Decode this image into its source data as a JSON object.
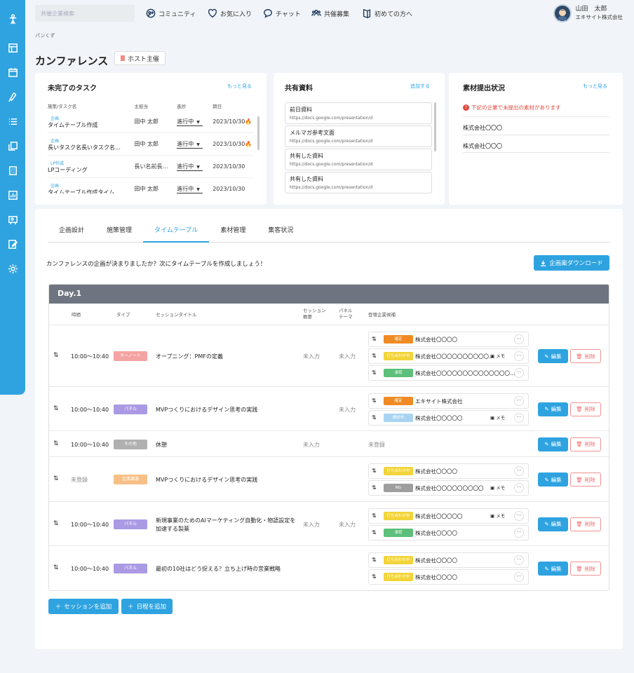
{
  "search": {
    "placeholder": "共催企業検索"
  },
  "topnav": [
    {
      "label": "コミュニティ",
      "icon": "community-icon"
    },
    {
      "label": "お気に入り",
      "icon": "heart-icon"
    },
    {
      "label": "チャット",
      "icon": "chat-icon"
    },
    {
      "label": "共催募集",
      "icon": "people-icon"
    },
    {
      "label": "初めての方へ",
      "icon": "book-icon"
    }
  ],
  "user": {
    "name": "山田　太郎",
    "company": "エキサイト株式会社"
  },
  "breadcrumb": "パンくず",
  "page": {
    "title": "カンファレンス",
    "host_badge": "ホスト主催"
  },
  "tasks": {
    "title": "未完了のタスク",
    "more": "もっと見る",
    "headers": [
      "施策/タスク名",
      "主担当",
      "進捗",
      "期日"
    ],
    "rows": [
      {
        "category": "企画",
        "name": "タイムテーブル作成",
        "owner": "田中 太郎",
        "status": "進行中",
        "due": "2023/10/30",
        "flame": true
      },
      {
        "category": "企画",
        "name": "長いタスク名長いタスク名…",
        "owner": "田中 太郎",
        "status": "進行中",
        "due": "2023/10/30",
        "flame": true
      },
      {
        "category": "LP作成",
        "name": "LPコーディング",
        "owner": "長い名前長…",
        "status": "進行中",
        "due": "2023/10/30",
        "flame": false
      },
      {
        "category": "企画",
        "name": "タイムテーブル作成タイム…",
        "owner": "田中 太郎",
        "status": "進行中",
        "due": "2023/10/30",
        "flame": false
      }
    ]
  },
  "docs": {
    "title": "共有資料",
    "add": "追加する",
    "items": [
      {
        "title": "前日資料",
        "url": "https://docs.google.com/presentation/d"
      },
      {
        "title": "メルマガ参考文面",
        "url": "https://docs.google.com/presentation/d"
      },
      {
        "title": "共有した資料",
        "url": "https://docs.google.com/presentation/d"
      },
      {
        "title": "共有した資料",
        "url": "https://docs.google.com/presentation/d"
      }
    ]
  },
  "materials": {
    "title": "素材提出状況",
    "more": "もっと見る",
    "warning": "下記の企業で未提出の素材があります",
    "companies": [
      "株式会社〇〇〇",
      "株式会社〇〇〇"
    ]
  },
  "tabs": [
    "企画設計",
    "施策管理",
    "タイムテーブル",
    "素材管理",
    "集客状況"
  ],
  "intro": "カンファレンスの企画が決まりましたか？次にタイムテーブルを作成しましょう！",
  "download_label": "企画案ダウンロード",
  "day": {
    "label": "Day.1",
    "headers": {
      "time": "時間",
      "type": "タイプ",
      "title": "セッションタイトル",
      "overview": "セッション\n概要",
      "panel": "パネル\nテーマ",
      "companies": "登壇企業候補"
    },
    "edit_label": "編集",
    "delete_label": "削除",
    "memo_label": "メモ",
    "sessions": [
      {
        "time": "10:00〜10:40",
        "type": "キーノート",
        "type_color": "#f4a3a3",
        "title": "オープニング：PMFの定義",
        "overview": "未入力",
        "panel": "未入力",
        "entries": [
          {
            "status": "確定",
            "color": "#f08a24",
            "name": "株式会社〇〇〇〇",
            "memo": false
          },
          {
            "status": "打ち合わせ中",
            "color": "#f2d43a",
            "name": "株式会社〇〇〇〇〇〇〇〇〇〇…",
            "memo": true
          },
          {
            "status": "承認",
            "color": "#5cc07a",
            "name": "株式会社〇〇〇〇〇〇〇〇〇〇〇〇〇〇…",
            "memo": false
          }
        ]
      },
      {
        "time": "10:00〜10:40",
        "type": "パネル",
        "type_color": "#a99ae3",
        "title": "MVPつくりにおけるデザイン思考の実践",
        "overview": "",
        "panel": "未入力",
        "entries": [
          {
            "status": "確定",
            "color": "#f08a24",
            "name": "エキサイト株式会社",
            "memo": false
          },
          {
            "status": "検討中",
            "color": "#a8d4f2",
            "name": "株式会社〇〇〇〇〇",
            "memo": true
          }
        ]
      },
      {
        "time": "10:00〜10:40",
        "type": "その他",
        "type_color": "#b0b0b0",
        "title": "休憩",
        "overview": "未入力",
        "panel": "",
        "companies_empty": "未登録",
        "entries": []
      },
      {
        "time": "未登録",
        "type": "企業講演",
        "type_color": "#f7bf85",
        "title": "MVPつくりにおけるデザイン思考の実践",
        "overview": "",
        "panel": "",
        "entries": [
          {
            "status": "打ち合わせ中",
            "color": "#f2d43a",
            "name": "株式会社〇〇〇〇",
            "memo": false
          },
          {
            "status": "NG",
            "color": "#9e9e9e",
            "name": "株式会社〇〇〇〇〇〇〇〇〇",
            "memo": true
          }
        ]
      },
      {
        "time": "10:00〜10:40",
        "type": "パネル",
        "type_color": "#a99ae3",
        "title": "新規事業のためのAIマーケティング自動化・物語設定を加速する製薬",
        "overview": "未入力",
        "panel": "未入力",
        "entries": [
          {
            "status": "打ち合わせ中",
            "color": "#f2d43a",
            "name": "株式会社〇〇〇〇〇",
            "memo": true
          },
          {
            "status": "承認",
            "color": "#5cc07a",
            "name": "株式会社〇〇〇〇",
            "memo": false
          }
        ]
      },
      {
        "time": "10:00〜10:40",
        "type": "パネル",
        "type_color": "#a99ae3",
        "title": "最初の10社はどう捉える？立ち上げ時の営業戦略",
        "overview": "",
        "panel": "",
        "entries": [
          {
            "status": "打ち合わせ中",
            "color": "#f2d43a",
            "name": "株式会社〇〇〇〇",
            "memo": false
          },
          {
            "status": "打ち合わせ中",
            "color": "#f2d43a",
            "name": "株式会社〇〇〇〇",
            "memo": false
          }
        ]
      }
    ]
  },
  "add_session_label": "セッションを追加",
  "add_day_label": "日程を追加"
}
